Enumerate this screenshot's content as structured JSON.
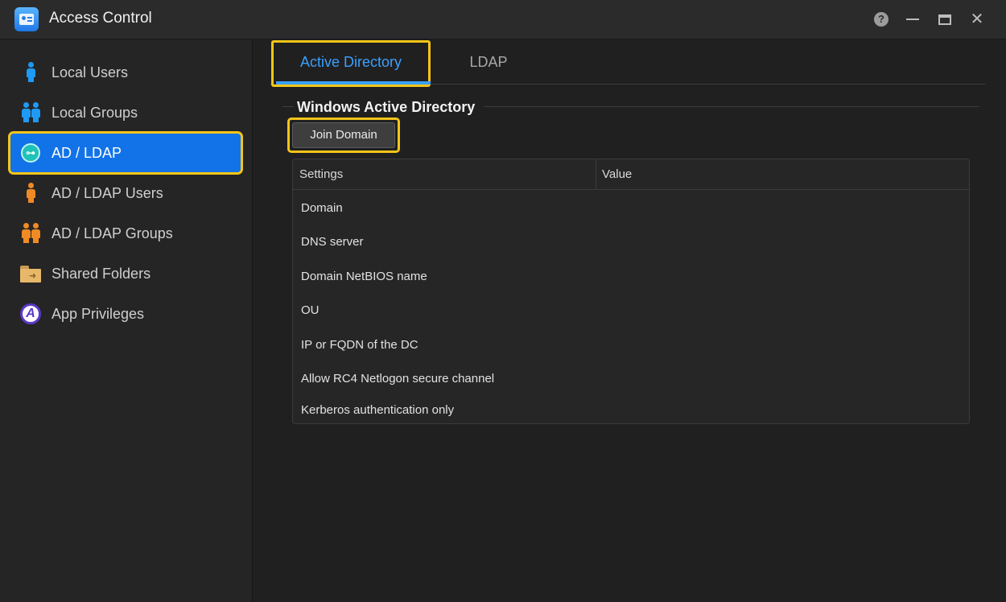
{
  "window": {
    "title": "Access Control",
    "controls": [
      "help-icon",
      "minimize-icon",
      "maximize-icon",
      "close-icon"
    ]
  },
  "sidebar": {
    "items": [
      {
        "label": "Local Users",
        "icon": "user-icon"
      },
      {
        "label": "Local Groups",
        "icon": "group-icon"
      },
      {
        "label": "AD / LDAP",
        "icon": "key-icon",
        "active": true
      },
      {
        "label": "AD / LDAP Users",
        "icon": "user-icon"
      },
      {
        "label": "AD / LDAP Groups",
        "icon": "group-icon"
      },
      {
        "label": "Shared Folders",
        "icon": "folder-icon"
      },
      {
        "label": "App Privileges",
        "icon": "app-privileges-icon"
      }
    ]
  },
  "tabs": [
    {
      "label": "Active Directory",
      "active": true
    },
    {
      "label": "LDAP",
      "active": false
    }
  ],
  "section": {
    "title": "Windows Active Directory",
    "join_button": "Join Domain"
  },
  "table": {
    "columns": [
      "Settings",
      "Value"
    ],
    "rows": [
      {
        "setting": "Domain",
        "value": ""
      },
      {
        "setting": "DNS server",
        "value": ""
      },
      {
        "setting": "Domain NetBIOS name",
        "value": ""
      },
      {
        "setting": "OU",
        "value": ""
      },
      {
        "setting": "IP or FQDN of the DC",
        "value": ""
      },
      {
        "setting": "Allow RC4 Netlogon secure channel",
        "value": ""
      },
      {
        "setting": "Kerberos authentication only",
        "value": ""
      }
    ]
  },
  "colors": {
    "accent": "#1273e8",
    "highlight": "#f5c518",
    "tab_active": "#3aa0ff"
  }
}
